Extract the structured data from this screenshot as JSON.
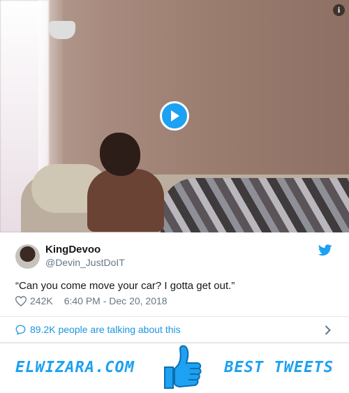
{
  "tweet": {
    "name": "KingDevoo",
    "handle": "@Devin_JustDoIT",
    "text": "“Can you come move your car? I gotta get out.”",
    "likes": "242K",
    "timestamp": "6:40 PM - Dec 20, 2018"
  },
  "talking": {
    "label": "89.2K people are talking about this"
  },
  "banner": {
    "site": "ELWIZARA.COM",
    "tagline": "BEST TWEETS"
  },
  "colors": {
    "twitter_blue": "#1da1f2",
    "link_blue": "#1b95e0",
    "gray_text": "#657786"
  },
  "icons": {
    "info": "info-icon",
    "play": "play-icon",
    "bird": "twitter-bird-icon",
    "heart": "heart-icon",
    "comment": "comment-icon",
    "chevron": "chevron-right-icon",
    "thumb": "thumbs-up-icon"
  }
}
